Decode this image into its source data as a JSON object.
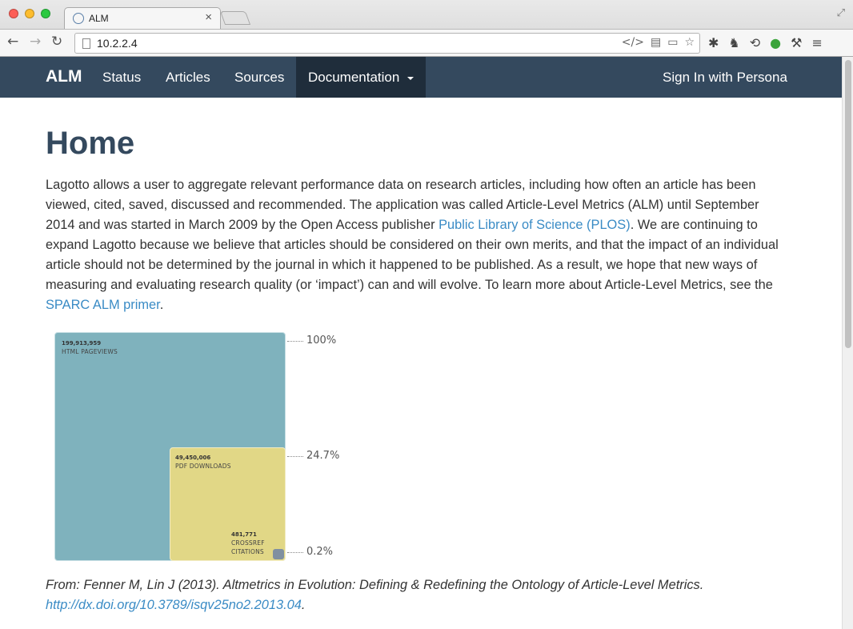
{
  "browser": {
    "tab_title": "ALM",
    "tab_close": "×",
    "url": "10.2.2.4"
  },
  "navbar": {
    "brand": "ALM",
    "items": [
      {
        "label": "Status"
      },
      {
        "label": "Articles"
      },
      {
        "label": "Sources"
      },
      {
        "label": "Documentation"
      }
    ],
    "signin": "Sign In with Persona"
  },
  "page": {
    "title": "Home",
    "intro_before_link1": "Lagotto allows a user to aggregate relevant performance data on research articles, including how often an article has been viewed, cited, saved, discussed and recommended. The application was called Article-Level Metrics (ALM) until September 2014 and was started in March 2009 by the Open Access publisher ",
    "link1": "Public Library of Science (PLOS)",
    "intro_between": ". We are continuing to expand Lagotto because we believe that articles should be considered on their own merits, and that the impact of an individual article should not be determined by the journal in which it happened to be published. As a result, we hope that new ways of measuring and evaluating research quality (or ‘impact’) can and will evolve. To learn more about Article-Level Metrics, see the ",
    "link2": "SPARC ALM primer",
    "intro_end": ".",
    "citation_text": "From: Fenner M, Lin J (2013). Altmetrics in Evolution: Defining & Redefining the Ontology of Article-Level Metrics.",
    "citation_link": "http://dx.doi.org/10.3789/isqv25no2.2013.04",
    "citation_end": "."
  },
  "figure": {
    "html_value": "199,913,959",
    "html_label": "HTML PAGEVIEWS",
    "pdf_value": "49,450,006",
    "pdf_label": "PDF DOWNLOADS",
    "cite_value": "481,771",
    "cite_label1": "CROSSREF",
    "cite_label2": "CITATIONS",
    "pct_html": "100%",
    "pct_pdf": "24.7%",
    "pct_cite": "0.2%",
    "colors": {
      "html": "#7fb2bd",
      "pdf": "#e1d786",
      "cite": "#8090a0"
    }
  }
}
